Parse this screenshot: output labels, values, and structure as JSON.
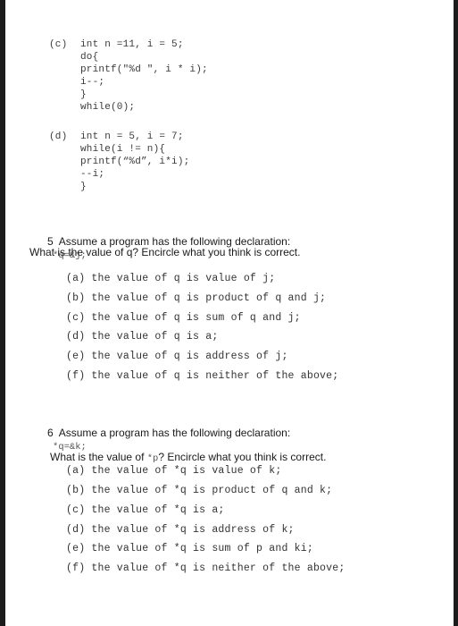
{
  "part_c": {
    "label": "(c)",
    "lines": [
      "int n =11, i = 5;",
      "do{",
      "printf(\"%d \", i * i);",
      "i--;",
      "}",
      "while(0);"
    ]
  },
  "part_d": {
    "label": "(d)",
    "lines": [
      "int n = 5, i = 7;",
      "while(i != n){",
      "printf(“%d”, i*i);",
      "--i;",
      "}"
    ]
  },
  "q5": {
    "prompt": "5  Assume a program has the following declaration:",
    "declaration": "*q=&j;",
    "question": "What is the value of q? Encircle what you think is correct.",
    "options": [
      "(a) the value of q is value of j;",
      "(b) the value of q is product of q and j;",
      "(c) the value of q is sum of q and j;",
      "(d) the value of q is a;",
      "(e) the value of q is address of j;",
      "(f) the value of q is neither of the above;"
    ]
  },
  "q6": {
    "prompt": "6  Assume a program has the following declaration:",
    "declaration": "*q=&k;",
    "question_pre": "What is the value of ",
    "question_code": "*p",
    "question_post": "? Encircle what you think is correct.",
    "options": [
      "(a) the value of *q is value of k;",
      "(b) the value of *q is product of q and k;",
      "(c) the value of *q is a;",
      "(d) the value of *q is address of k;",
      "(e) the value of *q is sum of p and ki;",
      "(f) the value of *q is neither of the above;"
    ]
  }
}
